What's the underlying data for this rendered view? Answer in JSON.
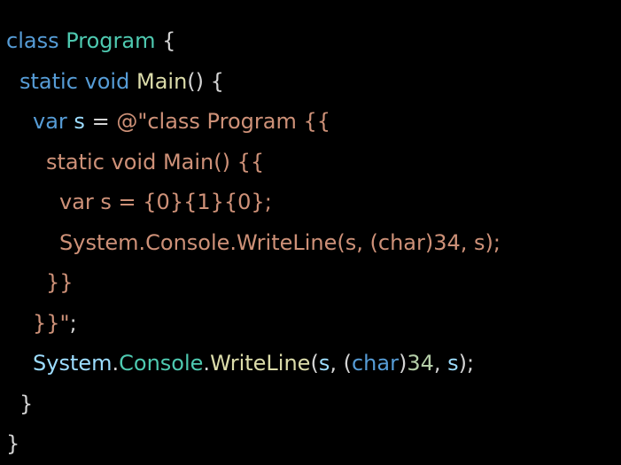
{
  "colors": {
    "background": "#000000",
    "keyword": "#569cd6",
    "type": "#4ec9b0",
    "method": "#dcdcaa",
    "string": "#ce9178",
    "variable": "#9cdcfe",
    "number": "#b5cea8",
    "punctuation": "#d4d4d4"
  },
  "lines": [
    {
      "indent": 0,
      "tokens": [
        {
          "text": "class",
          "kind": "keyword"
        },
        {
          "text": " ",
          "kind": "punctuation"
        },
        {
          "text": "Program",
          "kind": "type"
        },
        {
          "text": " {",
          "kind": "punctuation"
        }
      ]
    },
    {
      "indent": 1,
      "tokens": [
        {
          "text": "static",
          "kind": "keyword"
        },
        {
          "text": " ",
          "kind": "punctuation"
        },
        {
          "text": "void",
          "kind": "keyword"
        },
        {
          "text": " ",
          "kind": "punctuation"
        },
        {
          "text": "Main",
          "kind": "method"
        },
        {
          "text": "() {",
          "kind": "punctuation"
        }
      ]
    },
    {
      "indent": 2,
      "tokens": [
        {
          "text": "var",
          "kind": "keyword"
        },
        {
          "text": " ",
          "kind": "punctuation"
        },
        {
          "text": "s",
          "kind": "variable"
        },
        {
          "text": " = ",
          "kind": "punctuation"
        },
        {
          "text": "@\"class Program {{",
          "kind": "string"
        }
      ]
    },
    {
      "indent": 3,
      "tokens": [
        {
          "text": "static void Main() {{",
          "kind": "string"
        }
      ]
    },
    {
      "indent": 4,
      "tokens": [
        {
          "text": "var s = {0}{1}{0};",
          "kind": "string"
        }
      ]
    },
    {
      "indent": 4,
      "tokens": [
        {
          "text": "System.Console.WriteLine(s, (char)34, s);",
          "kind": "string"
        }
      ]
    },
    {
      "indent": 3,
      "tokens": [
        {
          "text": "}}",
          "kind": "string"
        }
      ]
    },
    {
      "indent": 2,
      "tokens": [
        {
          "text": "}}\"",
          "kind": "string"
        },
        {
          "text": ";",
          "kind": "punctuation"
        }
      ]
    },
    {
      "indent": 2,
      "tokens": [
        {
          "text": "System",
          "kind": "variable"
        },
        {
          "text": ".",
          "kind": "punctuation"
        },
        {
          "text": "Console",
          "kind": "type"
        },
        {
          "text": ".",
          "kind": "punctuation"
        },
        {
          "text": "WriteLine",
          "kind": "method"
        },
        {
          "text": "(",
          "kind": "punctuation"
        },
        {
          "text": "s",
          "kind": "variable"
        },
        {
          "text": ", (",
          "kind": "punctuation"
        },
        {
          "text": "char",
          "kind": "keyword"
        },
        {
          "text": ")",
          "kind": "punctuation"
        },
        {
          "text": "34",
          "kind": "number"
        },
        {
          "text": ", ",
          "kind": "punctuation"
        },
        {
          "text": "s",
          "kind": "variable"
        },
        {
          "text": ");",
          "kind": "punctuation"
        }
      ]
    },
    {
      "indent": 1,
      "tokens": [
        {
          "text": "}",
          "kind": "punctuation"
        }
      ]
    },
    {
      "indent": 0,
      "tokens": [
        {
          "text": "}",
          "kind": "punctuation"
        }
      ]
    }
  ]
}
